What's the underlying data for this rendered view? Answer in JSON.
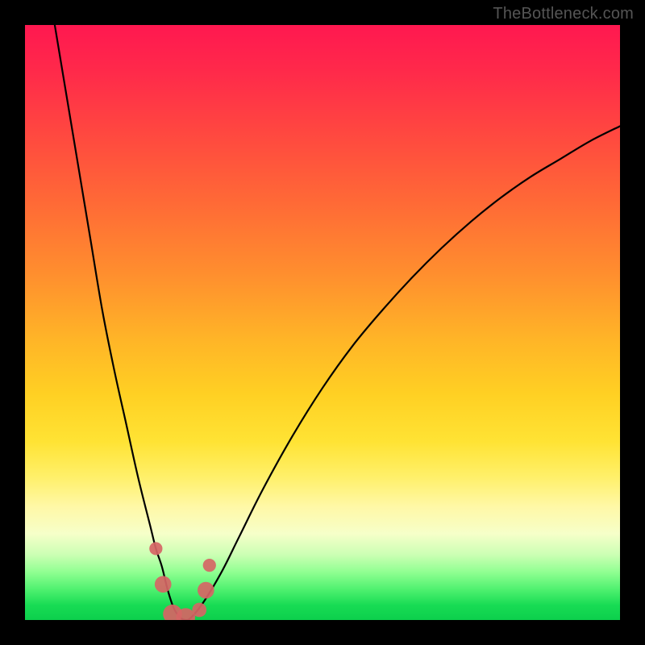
{
  "attribution": "TheBottleneck.com",
  "colors": {
    "frame": "#000000",
    "curve": "#000000",
    "markers": "#d66565",
    "gradient_top": "#ff1850",
    "gradient_bottom": "#0ccf4c"
  },
  "chart_data": {
    "type": "line",
    "title": "",
    "xlabel": "",
    "ylabel": "",
    "xlim": [
      0,
      100
    ],
    "ylim": [
      0,
      100
    ],
    "note": "Axes are not labeled in source image; 0-100 is an assumed percent scale. y=0 at top, y=100 at bottom (green) as drawn.",
    "series": [
      {
        "name": "bottleneck-curve",
        "x": [
          5,
          7,
          9,
          11,
          13,
          15,
          17,
          19,
          21,
          22,
          23,
          24,
          25,
          26,
          27,
          28,
          30,
          33,
          36,
          40,
          45,
          50,
          55,
          60,
          65,
          70,
          75,
          80,
          85,
          90,
          95,
          100
        ],
        "y": [
          0,
          12,
          24,
          36,
          48,
          58,
          67,
          76,
          84,
          88,
          91,
          95,
          98,
          99.5,
          100,
          99.5,
          97,
          92,
          86,
          78,
          69,
          61,
          54,
          48,
          42.5,
          37.5,
          33,
          29,
          25.5,
          22.5,
          19.5,
          17
        ]
      }
    ],
    "markers": [
      {
        "name": "left-upper-dot",
        "x": 22.0,
        "y": 88.0,
        "r": 1.1
      },
      {
        "name": "left-mid-blob",
        "x": 23.2,
        "y": 94.0,
        "r": 1.4
      },
      {
        "name": "bottom-left-blob",
        "x": 24.8,
        "y": 99.0,
        "r": 1.6
      },
      {
        "name": "bottom-mid-blob",
        "x": 27.0,
        "y": 99.6,
        "r": 1.6
      },
      {
        "name": "bottom-right-dot",
        "x": 29.3,
        "y": 98.3,
        "r": 1.2
      },
      {
        "name": "right-upper-blob",
        "x": 30.4,
        "y": 95.0,
        "r": 1.4
      },
      {
        "name": "right-top-dot",
        "x": 31.0,
        "y": 90.8,
        "r": 1.1
      }
    ]
  }
}
